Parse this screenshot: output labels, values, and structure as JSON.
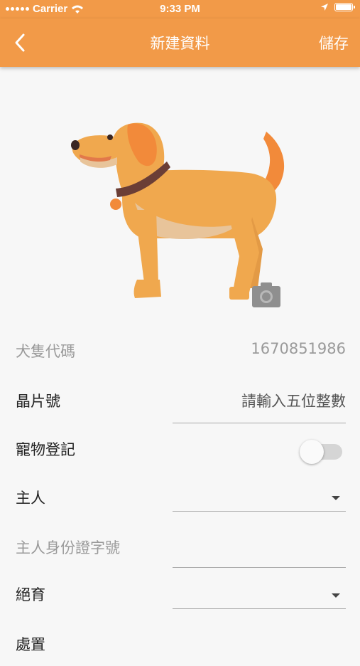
{
  "status_bar": {
    "carrier": "Carrier",
    "time": "9:33 PM"
  },
  "nav": {
    "title": "新建資料",
    "save_label": "儲存"
  },
  "form": {
    "dog_code": {
      "label": "犬隻代碼",
      "value": "1670851986"
    },
    "chip_number": {
      "label": "晶片號",
      "placeholder": "請輸入五位整數"
    },
    "pet_registration": {
      "label": "寵物登記",
      "enabled": false
    },
    "owner": {
      "label": "主人",
      "value": ""
    },
    "owner_id": {
      "label": "主人身份證字號",
      "value": ""
    },
    "neutered": {
      "label": "絕育",
      "value": ""
    },
    "partial_next": {
      "label": "處置"
    }
  },
  "colors": {
    "accent": "#f29a48"
  }
}
